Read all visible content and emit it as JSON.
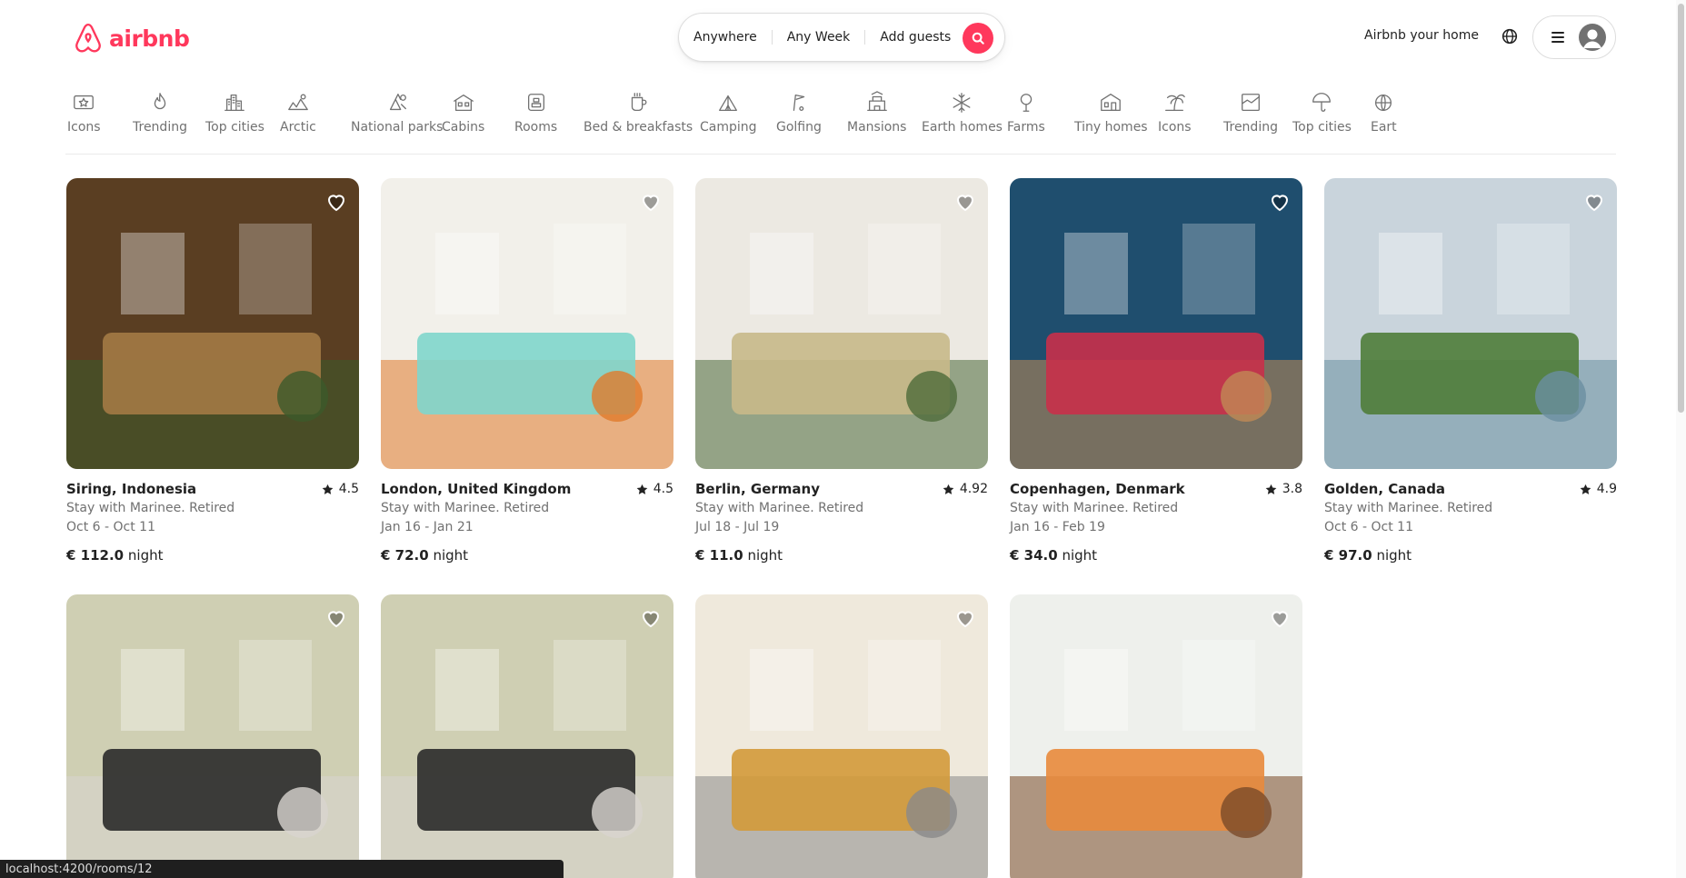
{
  "header": {
    "logo_text": "airbnb",
    "search": {
      "where": "Anywhere",
      "when": "Any Week",
      "who": "Add guests"
    },
    "host_link": "Airbnb your home"
  },
  "categories": [
    {
      "label": "Icons",
      "icon": "icons-icon"
    },
    {
      "label": "Trending",
      "icon": "flame-icon"
    },
    {
      "label": "Top cities",
      "icon": "city-icon"
    },
    {
      "label": "Arctic",
      "icon": "arctic-icon"
    },
    {
      "label": "National parks",
      "icon": "national-park-icon"
    },
    {
      "label": "Cabins",
      "icon": "cabin-icon"
    },
    {
      "label": "Rooms",
      "icon": "room-icon"
    },
    {
      "label": "Bed & breakfasts",
      "icon": "breakfast-icon"
    },
    {
      "label": "Camping",
      "icon": "camping-icon"
    },
    {
      "label": "Golfing",
      "icon": "golf-icon"
    },
    {
      "label": "Mansions",
      "icon": "mansion-icon"
    },
    {
      "label": "Earth homes",
      "icon": "snowflake-icon"
    },
    {
      "label": "Farms",
      "icon": "farm-icon"
    },
    {
      "label": "Tiny homes",
      "icon": "tiny-home-icon"
    },
    {
      "label": "Icons",
      "icon": "palm-icon"
    },
    {
      "label": "Trending",
      "icon": "trending-icon"
    },
    {
      "label": "Top cities",
      "icon": "umbrella-icon"
    },
    {
      "label": "Eart",
      "icon": "earth-icon"
    }
  ],
  "listings": [
    {
      "location": "Siring, Indonesia",
      "rating": "4.5",
      "host": "Stay with Marinee. Retired",
      "dates": "Oct 6 - Oct 11",
      "price": "€ 112.0",
      "unit": "night",
      "palette": [
        "#5a3e22",
        "#a37a45",
        "#3c5a2a"
      ]
    },
    {
      "location": "London, United Kingdom",
      "rating": "4.5",
      "host": "Stay with Marinee. Retired",
      "dates": "Jan 16 - Jan 21",
      "price": "€ 72.0",
      "unit": "night",
      "palette": [
        "#f2f0ea",
        "#7fd6cc",
        "#e07a2a"
      ]
    },
    {
      "location": "Berlin, Germany",
      "rating": "4.92",
      "host": "Stay with Marinee. Retired",
      "dates": "Jul 18 - Jul 19",
      "price": "€ 11.0",
      "unit": "night",
      "palette": [
        "#ece9e2",
        "#c8b98a",
        "#4d6a3a"
      ]
    },
    {
      "location": "Copenhagen, Denmark",
      "rating": "3.8",
      "host": "Stay with Marinee. Retired",
      "dates": "Jan 16 - Feb 19",
      "price": "€ 34.0",
      "unit": "night",
      "palette": [
        "#1f4e6e",
        "#c8304a",
        "#c08a55"
      ]
    },
    {
      "location": "Golden, Canada",
      "rating": "4.9",
      "host": "Stay with Marinee. Retired",
      "dates": "Oct 6 - Oct 11",
      "price": "€ 97.0",
      "unit": "night",
      "palette": [
        "#c9d4dc",
        "#4f7d3a",
        "#6a8fa1"
      ]
    },
    {
      "palette": [
        "#cfcfb3",
        "#2a2a2a",
        "#d8d5cf"
      ]
    },
    {
      "palette": [
        "#cfcfb3",
        "#2a2a2a",
        "#d8d5cf"
      ]
    },
    {
      "palette": [
        "#efe9dc",
        "#d39a3a",
        "#8a8a8a"
      ]
    },
    {
      "palette": [
        "#eef0ec",
        "#e88a3c",
        "#7a4a28"
      ]
    }
  ],
  "status_url": "localhost:4200/rooms/12",
  "colors": {
    "brand": "#ff385c",
    "muted": "#717171",
    "text": "#222222"
  }
}
